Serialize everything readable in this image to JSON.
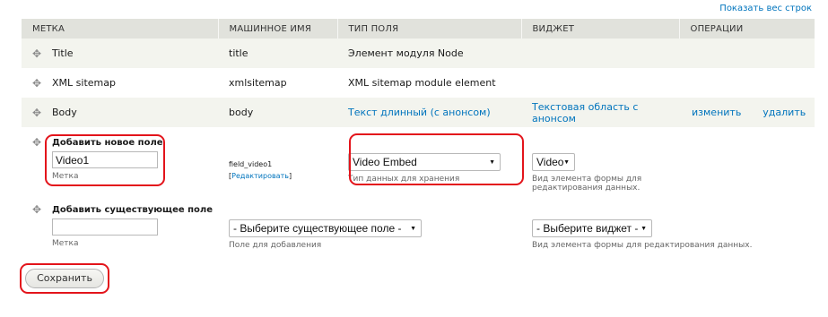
{
  "show_weights_link": "Показать вес строк",
  "table": {
    "headers": [
      "МЕТКА",
      "МАШИННОЕ ИМЯ",
      "ТИП ПОЛЯ",
      "ВИДЖЕТ",
      "ОПЕРАЦИИ"
    ],
    "rows": [
      {
        "label": "Title",
        "machine_name": "title",
        "field_type": "Элемент модуля Node",
        "widget": "",
        "edit": "",
        "delete": ""
      },
      {
        "label": "XML sitemap",
        "machine_name": "xmlsitemap",
        "field_type": "XML sitemap module element",
        "widget": "",
        "edit": "",
        "delete": ""
      },
      {
        "label": "Body",
        "machine_name": "body",
        "field_type": "Текст длинный (с анонсом)",
        "widget": "Текстовая область с анонсом",
        "edit": "изменить",
        "delete": "удалить"
      }
    ]
  },
  "add_new": {
    "title": "Добавить новое поле",
    "label_value": "Video1",
    "label_desc": "Метка",
    "machine_name": "field_video1",
    "machine_edit_open": "[",
    "machine_edit_link": "Редактировать",
    "machine_edit_close": "]",
    "field_type_value": "Video Embed",
    "field_type_desc": "Тип данных для хранения",
    "widget_value": "Video",
    "widget_desc": "Вид элемента формы для редактирования данных."
  },
  "add_existing": {
    "title": "Добавить существующее поле",
    "label_value": "",
    "label_desc": "Метка",
    "field_value": "- Выберите существующее поле -",
    "field_desc": "Поле для добавления",
    "widget_value": "- Выберите виджет -",
    "widget_desc": "Вид элемента формы для редактирования данных."
  },
  "save_button": "Сохранить",
  "icons": {
    "drag": "drag-handle-icon",
    "dropdown": "dropdown-arrow-icon"
  },
  "colors": {
    "link": "#0074bd",
    "highlight": "#e3141b",
    "header_bg": "#e1e2dc",
    "stripe": "#f3f4ee"
  }
}
